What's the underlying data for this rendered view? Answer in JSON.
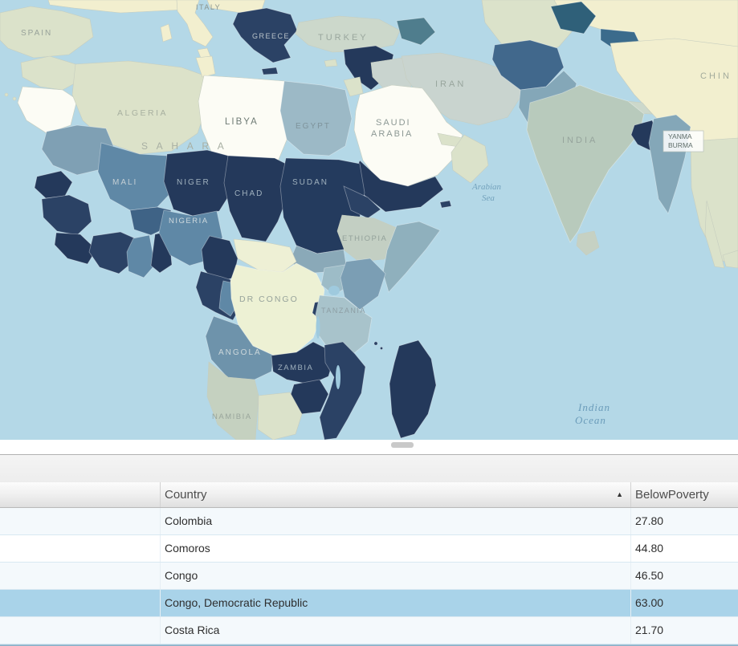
{
  "map": {
    "ocean_color": "#b4d8e7",
    "labels": {
      "italy": "ITALY",
      "spain": "SPAIN",
      "greece": "GREECE",
      "turkey": "TURKEY",
      "iran": "IRAN",
      "china": "CHIN",
      "algeria": "ALGERIA",
      "libya": "LIBYA",
      "egypt": "EGYPT",
      "sahara": "S A H A R A",
      "saudi1": "SAUDI",
      "saudi2": "ARABIA",
      "mali": "MALI",
      "niger": "NIGER",
      "chad": "CHAD",
      "sudan": "SUDAN",
      "nigeria": "NIGERIA",
      "ethiopia": "ETHIOPIA",
      "drcongo": "DR CONGO",
      "tanzania": "TANZANIA",
      "angola": "ANGOLA",
      "zambia": "ZAMBIA",
      "namibia": "NAMIBIA",
      "india": "INDIA",
      "myanmar1": "YANMA",
      "myanmar2": "BURMA",
      "arabian1": "Arabian",
      "arabian2": "Sea",
      "indian1": "Indian",
      "indian2": "Ocean"
    }
  },
  "table": {
    "header": {
      "country": "Country",
      "below_poverty": "BelowPoverty",
      "sort_icon": "▲"
    },
    "rows": [
      {
        "country": "Colombia",
        "below_poverty": "27.80"
      },
      {
        "country": "Comoros",
        "below_poverty": "44.80"
      },
      {
        "country": "Congo",
        "below_poverty": "46.50"
      },
      {
        "country": "Congo, Democratic Republic",
        "below_poverty": "63.00"
      },
      {
        "country": "Costa Rica",
        "below_poverty": "21.70"
      }
    ],
    "selected_row_index": 3,
    "sort": {
      "column": "Country",
      "direction": "ascending"
    }
  },
  "colors": {
    "ocean": "#b4d8e7",
    "selected_row": "#a9d3e9",
    "choropleth_dark": "#24395b",
    "choropleth_medium": "#5f88a6",
    "choropleth_light": "#a8c3cb",
    "basemap_land": "#f2efcf"
  }
}
